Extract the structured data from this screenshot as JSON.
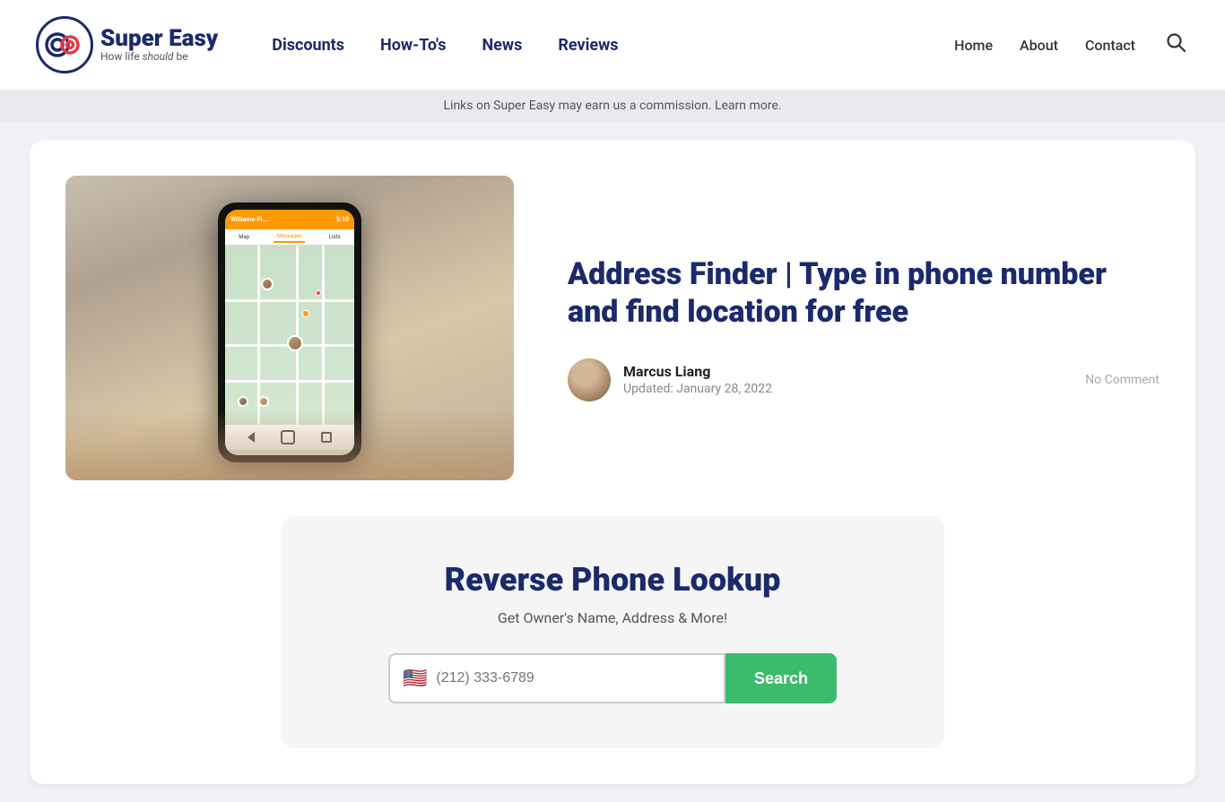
{
  "header": {
    "logo": {
      "name": "Super Easy",
      "tagline_prefix": "How life ",
      "tagline_em": "should",
      "tagline_suffix": " be"
    },
    "nav": {
      "items": [
        {
          "label": "Discounts",
          "href": "#"
        },
        {
          "label": "How-To's",
          "href": "#"
        },
        {
          "label": "News",
          "href": "#"
        },
        {
          "label": "Reviews",
          "href": "#"
        }
      ]
    },
    "right_nav": {
      "items": [
        {
          "label": "Home",
          "href": "#"
        },
        {
          "label": "About",
          "href": "#"
        },
        {
          "label": "Contact",
          "href": "#"
        }
      ]
    }
  },
  "commission_bar": {
    "text": "Links on Super Easy may earn us a commission. Learn more."
  },
  "article": {
    "title": "Address Finder | Type in phone number and find location for free",
    "author": {
      "name": "Marcus Liang",
      "updated_label": "Updated: January 28, 2022"
    },
    "comment_count": "No Comment"
  },
  "lookup_widget": {
    "title": "Reverse Phone Lookup",
    "subtitle": "Get Owner's Name, Address & More!",
    "input_placeholder": "(212) 333-6789",
    "search_label": "Search",
    "flag": "🇺🇸"
  }
}
